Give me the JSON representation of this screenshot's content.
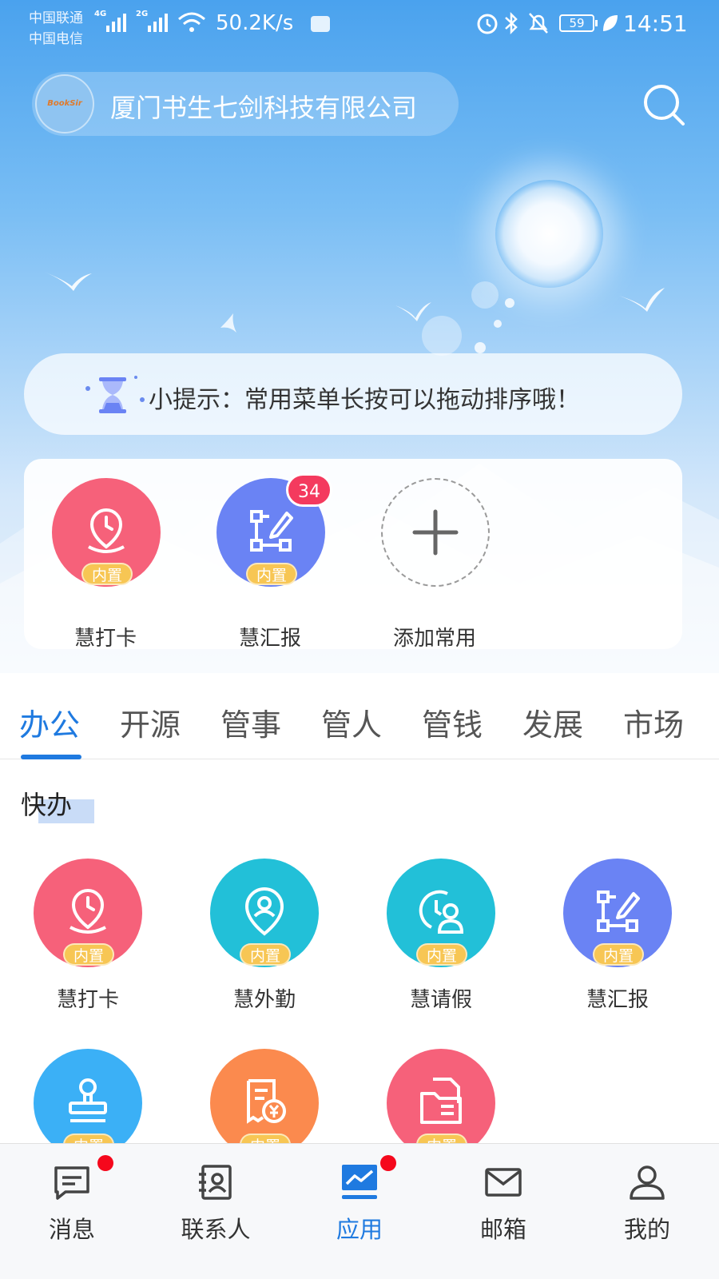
{
  "status_bar": {
    "carrier1": "中国联通",
    "carrier2": "中国电信",
    "sig1": "4G",
    "sig2": "2G",
    "net_speed": "50.2K/s",
    "battery": "59",
    "time": "14:51"
  },
  "header": {
    "logo_text": "BookSir",
    "company": "厦门书生七剑科技有限公司"
  },
  "tip": {
    "text": "小提示：常用菜单长按可以拖动排序哦！"
  },
  "favorites": [
    {
      "label": "慧打卡",
      "tag": "内置",
      "icon": "location-clock-icon",
      "color": "#f6617a"
    },
    {
      "label": "慧汇报",
      "tag": "内置",
      "icon": "flow-edit-icon",
      "color": "#6a83f4",
      "badge": "34"
    },
    {
      "label": "添加常用",
      "icon": "plus-icon"
    }
  ],
  "tabs": [
    "办公",
    "开源",
    "管事",
    "管人",
    "管钱",
    "发展",
    "市场"
  ],
  "active_tab": "办公",
  "section": {
    "title": "快办"
  },
  "apps": [
    {
      "label": "慧打卡",
      "tag": "内置",
      "icon": "location-clock-icon",
      "color": "#f6617a"
    },
    {
      "label": "慧外勤",
      "tag": "内置",
      "icon": "location-person-icon",
      "color": "#22c0d8"
    },
    {
      "label": "慧请假",
      "tag": "内置",
      "icon": "clock-person-icon",
      "color": "#22c0d8"
    },
    {
      "label": "慧汇报",
      "tag": "内置",
      "icon": "flow-edit-icon",
      "color": "#6a83f4"
    },
    {
      "label": "",
      "tag": "内置",
      "icon": "stamp-icon",
      "color": "#3bb0f6"
    },
    {
      "label": "",
      "tag": "内置",
      "icon": "receipt-yuan-icon",
      "color": "#fb8a4e"
    },
    {
      "label": "",
      "tag": "内置",
      "icon": "folder-doc-icon",
      "color": "#f6617a"
    }
  ],
  "bottom_nav": [
    {
      "label": "消息",
      "icon": "message-icon",
      "dot": true
    },
    {
      "label": "联系人",
      "icon": "contacts-icon",
      "dot": false
    },
    {
      "label": "应用",
      "icon": "apps-chart-icon",
      "dot": true,
      "active": true
    },
    {
      "label": "邮箱",
      "icon": "mail-icon",
      "dot": false
    },
    {
      "label": "我的",
      "icon": "profile-icon",
      "dot": false
    }
  ],
  "colors": {
    "accent": "#1f7ae0",
    "badge": "#f43a5e",
    "tag": "#f7c654"
  }
}
